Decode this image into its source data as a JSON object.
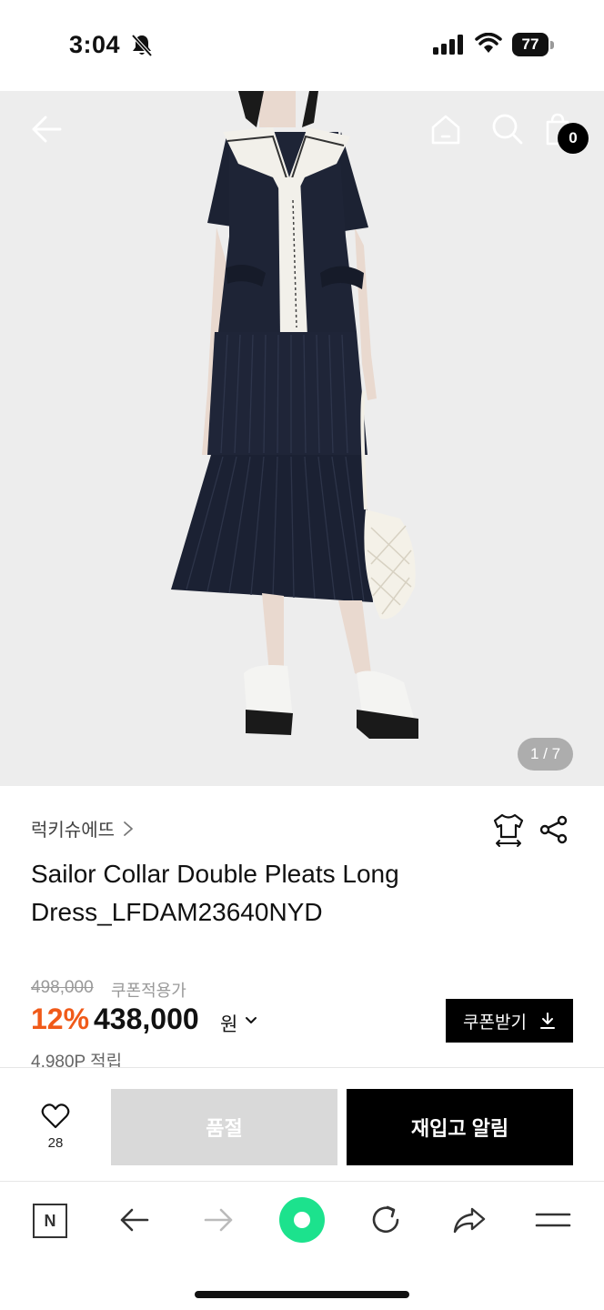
{
  "status_bar": {
    "time": "3:04",
    "battery": "77",
    "icons": [
      "bell-slash-icon",
      "signal-icon",
      "wifi-icon",
      "battery-icon"
    ]
  },
  "header": {
    "icons": [
      "back-arrow-icon",
      "home-icon",
      "search-icon",
      "shopping-bag-icon"
    ],
    "cart_count": "0"
  },
  "gallery": {
    "counter": "1 / 7"
  },
  "product": {
    "brand": "럭키슈에뜨",
    "title": "Sailor Collar Double Pleats Long Dress_LFDAM23640NYD",
    "original_price": "498,000",
    "coupon_label": "쿠폰적용가",
    "discount": "12%",
    "price": "438,000",
    "currency": "원",
    "coupon_button": "쿠폰받기",
    "points": "4,980P 적립"
  },
  "purchase_bar": {
    "wish_count": "28",
    "soldout_label": "품절",
    "restock_label": "재입고 알림"
  },
  "browser_bar": {
    "n_label": "N",
    "icons": [
      "n-logo-icon",
      "back-arrow-icon",
      "forward-arrow-icon",
      "green-dot-icon",
      "reload-icon",
      "share-arrow-icon",
      "menu-icon"
    ]
  },
  "colors": {
    "discount": "#f05a19",
    "accent_green": "#1ce28d",
    "black": "#000000"
  }
}
